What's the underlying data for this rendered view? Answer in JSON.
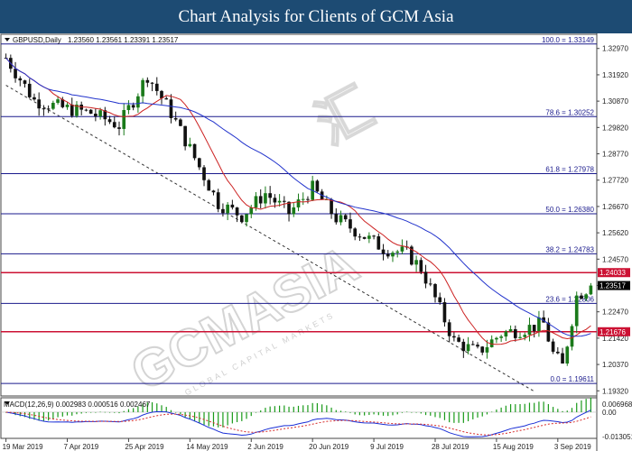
{
  "banner": {
    "title": "Chart Analysis for Clients of GCM Asia"
  },
  "header": {
    "symbol": "GBPUSD,Daily",
    "ohlc": "1.23560 1.23561 1.23391 1.23517",
    "macd": "MACD(12,26,9) 0.002983 0.000516 0.002467"
  },
  "watermark": "GCMASIA",
  "watermark_sub": "GLOBAL CAPITAL MARKETS",
  "watermark_chinese": "汇",
  "colors": {
    "bull": "#1a7a1a",
    "bear": "#111111",
    "ma_fast": "#cc2222",
    "ma_slow": "#2233cc",
    "fib": "#1a1a8c",
    "resistance": "#cc1133",
    "price_tag": "#000000",
    "macd_hist": "#1a9a1a",
    "macd_line": "#1a2fd6",
    "signal_line": "#d62a2a"
  },
  "chart_data": [
    {
      "type": "candlestick",
      "title": "GBPUSD,Daily",
      "ylim": [
        1.1915,
        1.335
      ],
      "y_ticks": [
        "1.32970",
        "1.31920",
        "1.30870",
        "1.29820",
        "1.28770",
        "1.27720",
        "1.26670",
        "1.25620",
        "1.24570",
        "1.23520",
        "1.22470",
        "1.21420",
        "1.20370",
        "1.19320"
      ],
      "x_labels": [
        "19 Mar 2019",
        "7 Apr 2019",
        "25 Apr 2019",
        "14 May 2019",
        "2 Jun 2019",
        "20 Jun 2019",
        "9 Jul 2019",
        "28 Jul 2019",
        "15 Aug 2019",
        "3 Sep 2019"
      ],
      "x_label_bars": [
        0,
        13,
        26,
        39,
        52,
        65,
        78,
        91,
        104,
        117
      ],
      "bars_count": 125,
      "price_path": [
        [
          0,
          1.326
        ],
        [
          6,
          1.309
        ],
        [
          12,
          1.306
        ],
        [
          18,
          1.304
        ],
        [
          24,
          1.299
        ],
        [
          30,
          1.319
        ],
        [
          35,
          1.304
        ],
        [
          40,
          1.286
        ],
        [
          45,
          1.268
        ],
        [
          50,
          1.263
        ],
        [
          55,
          1.272
        ],
        [
          60,
          1.264
        ],
        [
          65,
          1.274
        ],
        [
          70,
          1.262
        ],
        [
          75,
          1.256
        ],
        [
          80,
          1.25
        ],
        [
          85,
          1.248
        ],
        [
          88,
          1.242
        ],
        [
          91,
          1.23
        ],
        [
          95,
          1.213
        ],
        [
          100,
          1.2085
        ],
        [
          105,
          1.216
        ],
        [
          110,
          1.218
        ],
        [
          114,
          1.22
        ],
        [
          116,
          1.208
        ],
        [
          118,
          1.203
        ],
        [
          121,
          1.231
        ],
        [
          124,
          1.2352
        ]
      ],
      "fib_levels": [
        {
          "label": "100.0 = 1.33149",
          "value": 1.33149
        },
        {
          "label": "78.6 = 1.30252",
          "value": 1.30252
        },
        {
          "label": "61.8 = 1.27978",
          "value": 1.27978
        },
        {
          "label": "50.0 = 1.26380",
          "value": 1.2638
        },
        {
          "label": "38.2 = 1.24783",
          "value": 1.24783
        },
        {
          "label": "23.6 = 1.22806",
          "value": 1.22806
        },
        {
          "label": "0.0 = 1.19611",
          "value": 1.19611
        }
      ],
      "resistance_levels": [
        {
          "label": "1.24033",
          "value": 1.24033
        },
        {
          "label": "1.21676",
          "value": 1.21676
        }
      ],
      "current_price": {
        "label": "1.23517",
        "value": 1.23517
      },
      "trendline": [
        [
          0,
          1.315
        ],
        [
          112,
          1.193
        ]
      ],
      "moving_averages": [
        {
          "color": "#cc2222",
          "period": 10
        },
        {
          "color": "#2233cc",
          "period": 30
        }
      ]
    },
    {
      "type": "macd",
      "title": "MACD(12,26,9) 0.002983 0.000516 0.002467",
      "ylim": [
        -0.01305,
        0.00697
      ],
      "y_ticks": [
        "0.006968",
        "0.00",
        "-0.013051"
      ],
      "zero_line": 0
    }
  ]
}
